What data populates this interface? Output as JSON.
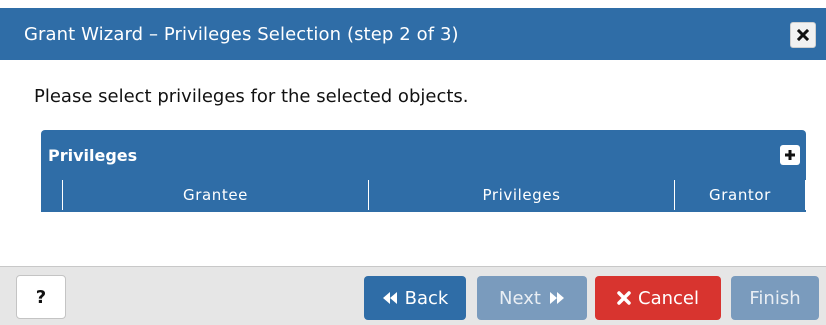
{
  "dialog": {
    "title": "Grant Wizard – Privileges Selection (step 2 of 3)",
    "close_icon": "close-icon"
  },
  "instruction": "Please select privileges for the selected objects.",
  "grid": {
    "title": "Privileges",
    "add_icon": "plus-icon",
    "columns": [
      "Grantee",
      "Privileges",
      "Grantor"
    ]
  },
  "footer": {
    "help_label": "?",
    "back_label": "Back",
    "next_label": "Next",
    "cancel_label": "Cancel",
    "finish_label": "Finish"
  },
  "colors": {
    "header_blue": "#2f6da7",
    "disabled_blue": "#7a9bbd",
    "cancel_red": "#d8342f",
    "footer_bg": "#e6e6e6"
  }
}
